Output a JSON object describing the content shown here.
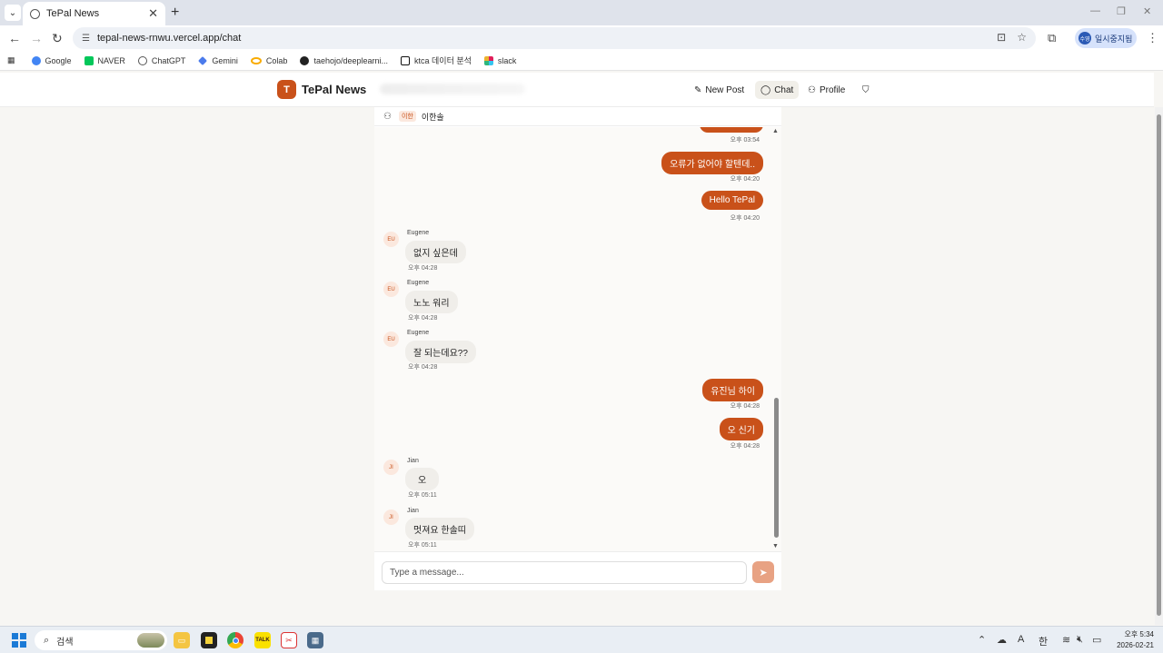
{
  "browser": {
    "tab_title": "TePal News",
    "tab_close": "✕",
    "new_tab": "+",
    "url": "tepal-news-rnwu.vercel.app/chat",
    "profile_label": "일시중지됨",
    "profile_initials": "수영",
    "window_min": "—",
    "window_max": "❐",
    "window_close": "✕"
  },
  "bookmarks": [
    {
      "label": "Google",
      "color": "#4285f4"
    },
    {
      "label": "NAVER",
      "color": "#03c75a"
    },
    {
      "label": "ChatGPT",
      "color": "#555555"
    },
    {
      "label": "Gemini",
      "color": "#4b7bec"
    },
    {
      "label": "Colab",
      "color": "#f9ab00"
    },
    {
      "label": "taehojo/deeplearni...",
      "color": "#222222"
    },
    {
      "label": "ktca 데이터 분석",
      "color": "#111111"
    },
    {
      "label": "slack",
      "color": "#e01e5a"
    }
  ],
  "app": {
    "logo_letter": "T",
    "logo_text": "TePal News",
    "nav": {
      "new_post": "New Post",
      "chat": "Chat",
      "profile": "Profile"
    },
    "accent": "#c9511a"
  },
  "chat": {
    "participants_tag": "이한",
    "participants_name": "이한솔",
    "messages": [
      {
        "mine": true,
        "text": "오류가 없어야 할텐데..",
        "time": "오후 04:20"
      },
      {
        "mine": true,
        "text": "Hello TePal",
        "time": "오후 04:20"
      },
      {
        "mine": false,
        "sender": "Eugene",
        "initials": "EU",
        "text": "없지 싶은데",
        "time": "오후 04:28"
      },
      {
        "mine": false,
        "sender": "Eugene",
        "initials": "EU",
        "text": "노노 워리",
        "time": "오후 04:28"
      },
      {
        "mine": false,
        "sender": "Eugene",
        "initials": "EU",
        "text": "잘 되는데요??",
        "time": "오후 04:28"
      },
      {
        "mine": true,
        "text": "유진님 하이",
        "time": "오후 04:28"
      },
      {
        "mine": true,
        "text": "오 신기",
        "time": "오후 04:28"
      },
      {
        "mine": false,
        "sender": "Jian",
        "initials": "JI",
        "text": "오",
        "time": "오후 05:11"
      },
      {
        "mine": false,
        "sender": "Jian",
        "initials": "JI",
        "text": "멋져요 한솔띠",
        "time": "오후 05:11"
      }
    ],
    "top_partial_time": "오후 03:54",
    "input_placeholder": "Type a message..."
  },
  "taskbar": {
    "search_label": "검색",
    "clock_time": "오후 5:34",
    "clock_date": "2026-02-21",
    "ime_a": "A",
    "ime_han": "한"
  }
}
